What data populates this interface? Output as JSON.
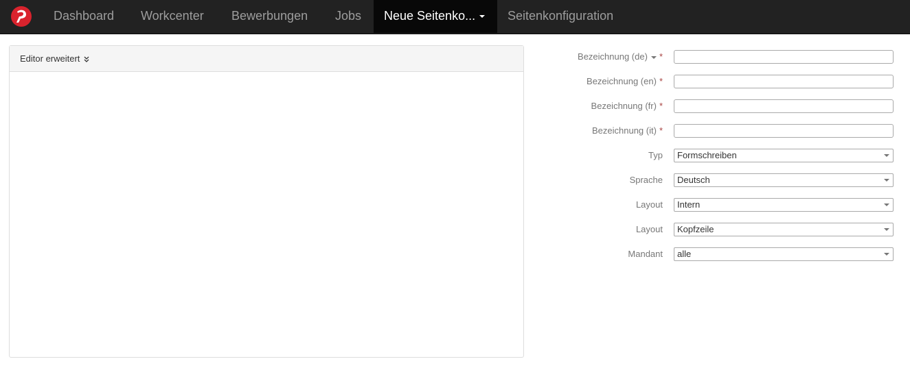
{
  "navbar": {
    "logo_icon": "brand-logo-icon",
    "items": [
      {
        "label": "Dashboard",
        "active": false
      },
      {
        "label": "Workcenter",
        "active": false
      },
      {
        "label": "Bewerbungen",
        "active": false
      },
      {
        "label": "Jobs",
        "active": false
      },
      {
        "label": "Neue Seitenko...",
        "active": true,
        "dropdown": true
      },
      {
        "label": "Seitenkonfiguration",
        "active": false
      }
    ],
    "colors": {
      "background": "#222222",
      "active": "#080808",
      "text": "#9d9d9d",
      "active_text": "#ffffff",
      "logo": "#d9232d"
    }
  },
  "editor": {
    "heading": "Editor erweitert",
    "toggle_icon": "double-chevron-down-icon"
  },
  "form": {
    "required_marker": "*",
    "fields": [
      {
        "label": "Bezeichnung (de)",
        "value": "",
        "required": true,
        "has_dropdown": true
      },
      {
        "label": "Bezeichnung (en)",
        "value": "",
        "required": true
      },
      {
        "label": "Bezeichnung (fr)",
        "value": "",
        "required": true
      },
      {
        "label": "Bezeichnung (it)",
        "value": "",
        "required": true
      }
    ],
    "selects": [
      {
        "label": "Typ",
        "value": "Formschreiben"
      },
      {
        "label": "Sprache",
        "value": "Deutsch"
      },
      {
        "label": "Layout",
        "value": "Intern"
      },
      {
        "label": "Layout",
        "value": "Kopfzeile"
      },
      {
        "label": "Mandant",
        "value": "alle"
      }
    ]
  }
}
